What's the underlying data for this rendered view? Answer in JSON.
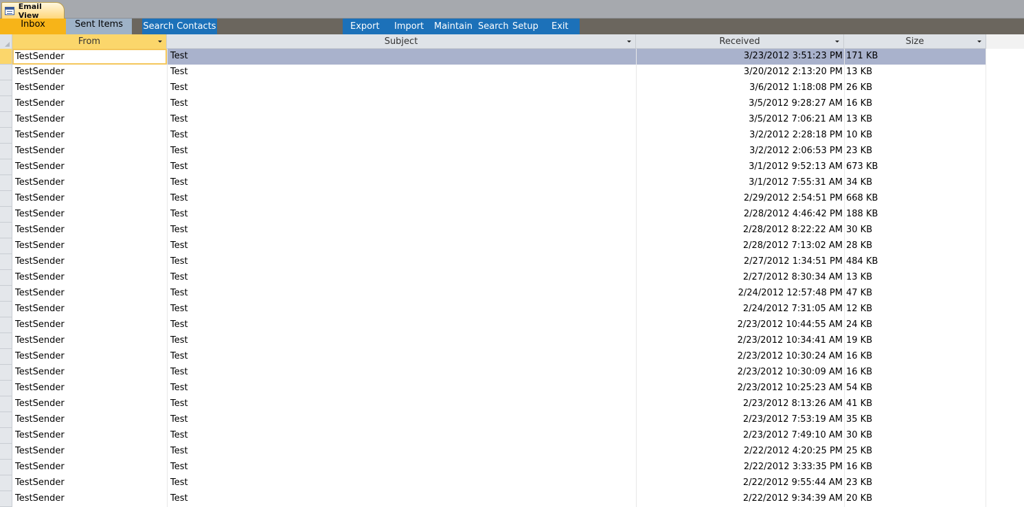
{
  "window": {
    "tab_title": "Email View"
  },
  "nav": {
    "inbox": "Inbox",
    "sent_items": "Sent Items",
    "search_contacts": "Search Contacts",
    "export": "Export",
    "import": "Import",
    "maintain": "Maintain",
    "search": "Search",
    "setup": "Setup",
    "exit": "Exit"
  },
  "colors": {
    "active_tab": "#f7b418",
    "inactive_tab": "#9eb2c7",
    "nav_blue": "#1c71b9",
    "nav_bar": "#6b665e",
    "selected_row": "#a9b2cc"
  },
  "columns": {
    "from": "From",
    "subject": "Subject",
    "received": "Received",
    "size": "Size"
  },
  "selected_row_index": 0,
  "rows": [
    {
      "from": "TestSender",
      "subject": "Test",
      "received": "3/23/2012 3:51:23 PM",
      "size": "171 KB"
    },
    {
      "from": "TestSender",
      "subject": "Test",
      "received": "3/20/2012 2:13:20 PM",
      "size": "13 KB"
    },
    {
      "from": "TestSender",
      "subject": "Test",
      "received": "3/6/2012 1:18:08 PM",
      "size": "26 KB"
    },
    {
      "from": "TestSender",
      "subject": "Test",
      "received": "3/5/2012 9:28:27 AM",
      "size": "16 KB"
    },
    {
      "from": "TestSender",
      "subject": "Test",
      "received": "3/5/2012 7:06:21 AM",
      "size": "13 KB"
    },
    {
      "from": "TestSender",
      "subject": "Test",
      "received": "3/2/2012 2:28:18 PM",
      "size": "10 KB"
    },
    {
      "from": "TestSender",
      "subject": "Test",
      "received": "3/2/2012 2:06:53 PM",
      "size": "23 KB"
    },
    {
      "from": "TestSender",
      "subject": "Test",
      "received": "3/1/2012 9:52:13 AM",
      "size": "673 KB"
    },
    {
      "from": "TestSender",
      "subject": "Test",
      "received": "3/1/2012 7:55:31 AM",
      "size": "34 KB"
    },
    {
      "from": "TestSender",
      "subject": "Test",
      "received": "2/29/2012 2:54:51 PM",
      "size": "668 KB"
    },
    {
      "from": "TestSender",
      "subject": "Test",
      "received": "2/28/2012 4:46:42 PM",
      "size": "188 KB"
    },
    {
      "from": "TestSender",
      "subject": "Test",
      "received": "2/28/2012 8:22:22 AM",
      "size": "30 KB"
    },
    {
      "from": "TestSender",
      "subject": "Test",
      "received": "2/28/2012 7:13:02 AM",
      "size": "28 KB"
    },
    {
      "from": "TestSender",
      "subject": "Test",
      "received": "2/27/2012 1:34:51 PM",
      "size": "484 KB"
    },
    {
      "from": "TestSender",
      "subject": "Test",
      "received": "2/27/2012 8:30:34 AM",
      "size": "13 KB"
    },
    {
      "from": "TestSender",
      "subject": "Test",
      "received": "2/24/2012 12:57:48 PM",
      "size": "47 KB"
    },
    {
      "from": "TestSender",
      "subject": "Test",
      "received": "2/24/2012 7:31:05 AM",
      "size": "12 KB"
    },
    {
      "from": "TestSender",
      "subject": "Test",
      "received": "2/23/2012 10:44:55 AM",
      "size": "24 KB"
    },
    {
      "from": "TestSender",
      "subject": "Test",
      "received": "2/23/2012 10:34:41 AM",
      "size": "19 KB"
    },
    {
      "from": "TestSender",
      "subject": "Test",
      "received": "2/23/2012 10:30:24 AM",
      "size": "16 KB"
    },
    {
      "from": "TestSender",
      "subject": "Test",
      "received": "2/23/2012 10:30:09 AM",
      "size": "16 KB"
    },
    {
      "from": "TestSender",
      "subject": "Test",
      "received": "2/23/2012 10:25:23 AM",
      "size": "54 KB"
    },
    {
      "from": "TestSender",
      "subject": "Test",
      "received": "2/23/2012 8:13:26 AM",
      "size": "41 KB"
    },
    {
      "from": "TestSender",
      "subject": "Test",
      "received": "2/23/2012 7:53:19 AM",
      "size": "35 KB"
    },
    {
      "from": "TestSender",
      "subject": "Test",
      "received": "2/23/2012 7:49:10 AM",
      "size": "30 KB"
    },
    {
      "from": "TestSender",
      "subject": "Test",
      "received": "2/22/2012 4:20:25 PM",
      "size": "25 KB"
    },
    {
      "from": "TestSender",
      "subject": "Test",
      "received": "2/22/2012 3:33:35 PM",
      "size": "16 KB"
    },
    {
      "from": "TestSender",
      "subject": "Test",
      "received": "2/22/2012 9:55:44 AM",
      "size": "23 KB"
    },
    {
      "from": "TestSender",
      "subject": "Test",
      "received": "2/22/2012 9:34:39 AM",
      "size": "20 KB"
    }
  ]
}
